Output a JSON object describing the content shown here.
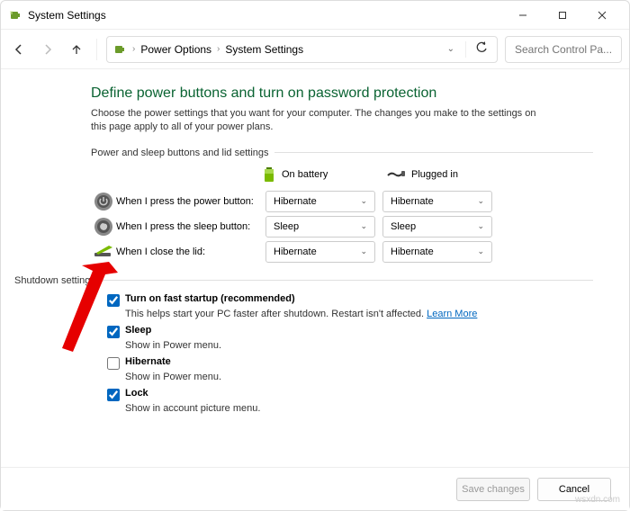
{
  "window": {
    "title": "System Settings"
  },
  "breadcrumb": {
    "item1": "Power Options",
    "item2": "System Settings"
  },
  "search": {
    "placeholder": "Search Control Pa..."
  },
  "page": {
    "heading": "Define power buttons and turn on password protection",
    "description": "Choose the power settings that you want for your computer. The changes you make to the settings on this page apply to all of your power plans."
  },
  "section1": {
    "label": "Power and sleep buttons and lid settings",
    "col_battery": "On battery",
    "col_plugged": "Plugged in",
    "rows": [
      {
        "label": "When I press the power button:",
        "battery": "Hibernate",
        "plugged": "Hibernate"
      },
      {
        "label": "When I press the sleep button:",
        "battery": "Sleep",
        "plugged": "Sleep"
      },
      {
        "label": "When I close the lid:",
        "battery": "Hibernate",
        "plugged": "Hibernate"
      }
    ]
  },
  "section2": {
    "label": "Shutdown settings",
    "items": [
      {
        "title": "Turn on fast startup (recommended)",
        "sub": "This helps start your PC faster after shutdown. Restart isn't affected.",
        "link": "Learn More",
        "checked": true
      },
      {
        "title": "Sleep",
        "sub": "Show in Power menu.",
        "checked": true
      },
      {
        "title": "Hibernate",
        "sub": "Show in Power menu.",
        "checked": false
      },
      {
        "title": "Lock",
        "sub": "Show in account picture menu.",
        "checked": true
      }
    ]
  },
  "buttons": {
    "save": "Save changes",
    "cancel": "Cancel"
  },
  "watermark": "wsxdn.com"
}
